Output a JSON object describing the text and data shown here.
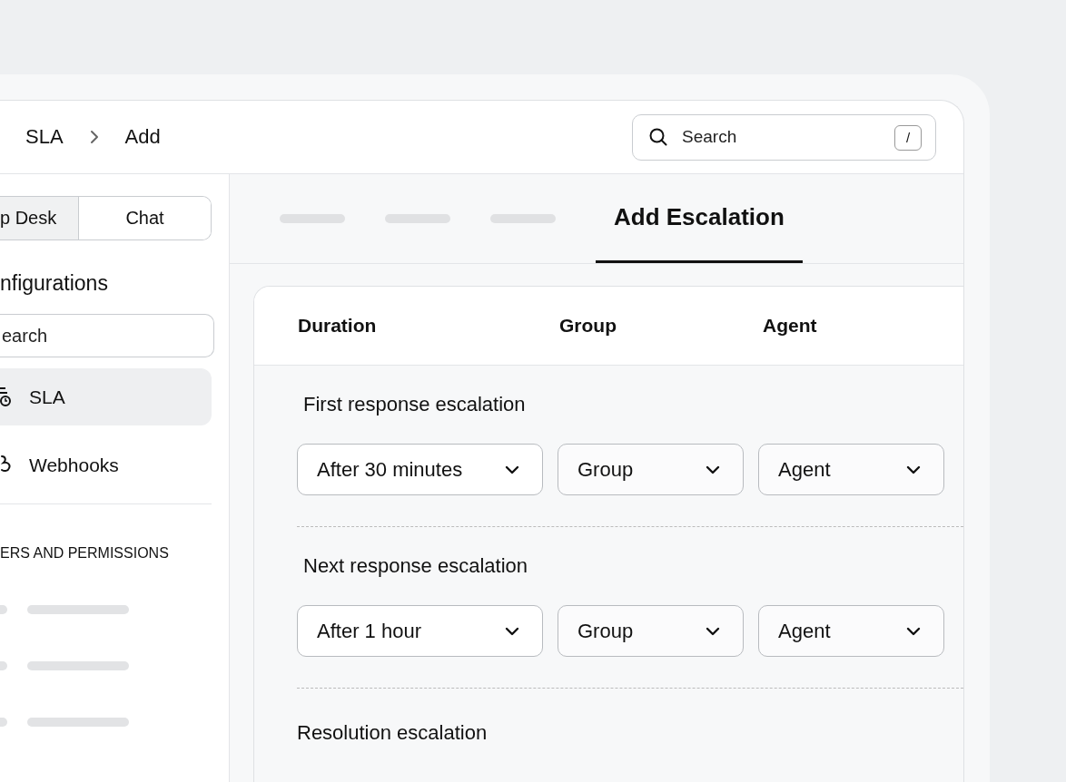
{
  "breadcrumb": [
    {
      "label": "SLA"
    },
    {
      "label": "Add"
    }
  ],
  "search": {
    "placeholder": "Search",
    "shortcut": "/"
  },
  "sidebar": {
    "segments": [
      {
        "label": "p Desk",
        "selected": true
      },
      {
        "label": "Chat",
        "selected": false
      }
    ],
    "heading": "nfigurations",
    "search": {
      "placeholder": "earch"
    },
    "items": [
      {
        "label": "SLA",
        "selected": true,
        "kind": "sla"
      },
      {
        "label": "Webhooks",
        "selected": false,
        "kind": "webhook"
      }
    ],
    "section": "ERS AND PERMISSIONS"
  },
  "tabs": [
    {
      "kind": "skeleton",
      "selected": false
    },
    {
      "kind": "skeleton",
      "selected": false
    },
    {
      "kind": "skeleton",
      "selected": false
    },
    {
      "kind": "label",
      "label": "Add Escalation",
      "selected": true
    }
  ],
  "columns": [
    "Duration",
    "Group",
    "Agent"
  ],
  "escalations": [
    {
      "title": "First response escalation",
      "duration": "After 30 minutes",
      "group": "Group",
      "agent": "Agent"
    },
    {
      "title": "Next response escalation",
      "duration": "After 1 hour",
      "group": "Group",
      "agent": "Agent"
    },
    {
      "title": "Resolution escalation"
    }
  ]
}
